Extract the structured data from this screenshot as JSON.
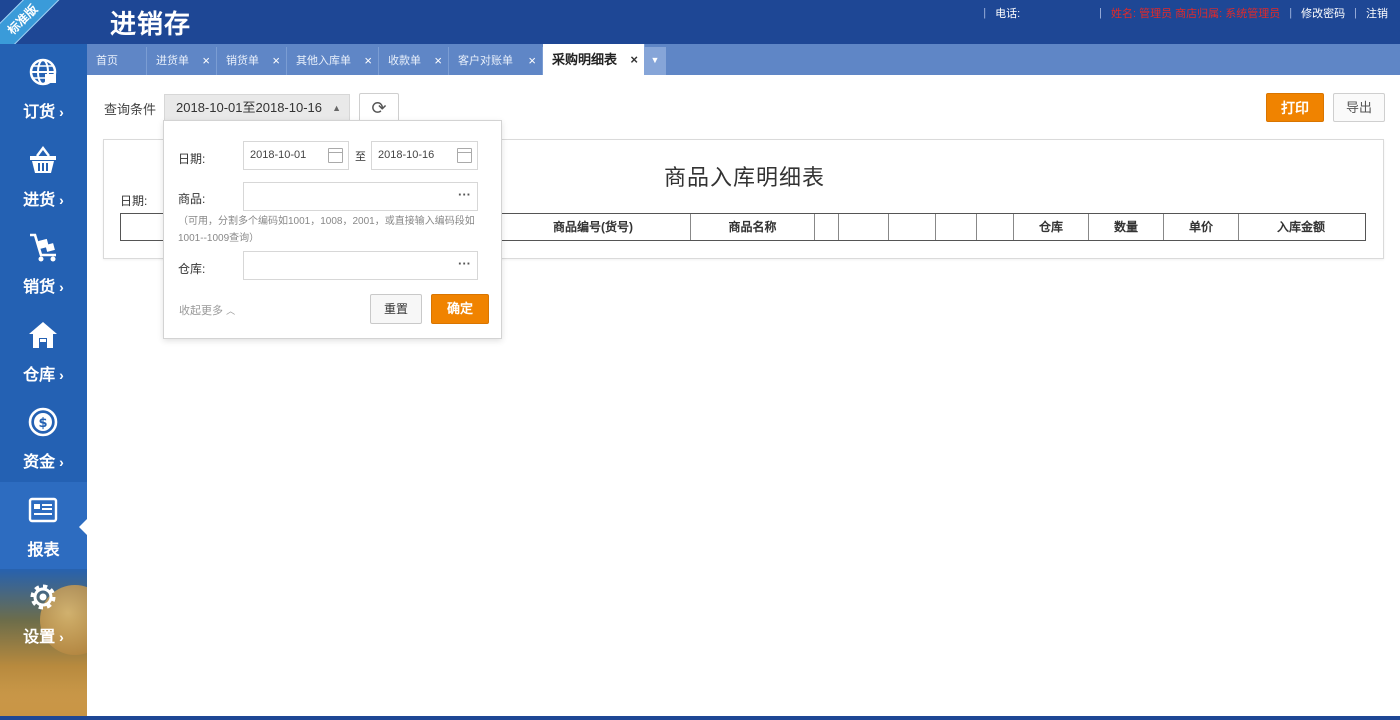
{
  "header": {
    "app_title": "进销存",
    "edition_badge": "标准版",
    "phone_label": "电话:",
    "phone_value": "",
    "user_info": "姓名: 管理员  商店归属: 系统管理员",
    "change_password": "修改密码",
    "logout": "注销"
  },
  "tabs": [
    {
      "label": "首页",
      "closable": false,
      "active": false
    },
    {
      "label": "进货单",
      "closable": true,
      "active": false
    },
    {
      "label": "销货单",
      "closable": true,
      "active": false
    },
    {
      "label": "其他入库单",
      "closable": true,
      "active": false
    },
    {
      "label": "收款单",
      "closable": true,
      "active": false
    },
    {
      "label": "客户对账单",
      "closable": true,
      "active": false
    },
    {
      "label": "采购明细表",
      "closable": true,
      "active": true
    }
  ],
  "tab_close_glyph": "×",
  "sidebar": {
    "items": [
      {
        "label": "订货",
        "icon": "globe-icon",
        "active": false
      },
      {
        "label": "进货",
        "icon": "basket-icon",
        "active": false
      },
      {
        "label": "销货",
        "icon": "cart-icon",
        "active": false
      },
      {
        "label": "仓库",
        "icon": "warehouse-icon",
        "active": false
      },
      {
        "label": "资金",
        "icon": "money-icon",
        "active": false
      },
      {
        "label": "报表",
        "icon": "report-icon",
        "active": true
      },
      {
        "label": "设置",
        "icon": "gear-icon",
        "active": false
      }
    ],
    "chevron": "›"
  },
  "toolbar": {
    "query_label": "查询条件",
    "date_range": "2018-10-01至2018-10-16",
    "print": "打印",
    "export": "导出"
  },
  "report": {
    "title": "商品入库明细表",
    "date_label": "日期:",
    "columns": [
      "",
      "",
      "",
      "",
      "",
      "商品编号(货号)",
      "商品名称",
      "",
      "",
      "",
      "",
      "",
      "仓库",
      "数量",
      "单价",
      "入库金额"
    ]
  },
  "filter_panel": {
    "date_label": "日期:",
    "date_from": "2018-10-01",
    "to_label": "至",
    "date_to": "2018-10-16",
    "product_label": "商品:",
    "product_value": "",
    "hint": "（可用，分割多个编码如1001，1008，2001，或直接输入编码段如1001--1009查询）",
    "warehouse_label": "仓库:",
    "warehouse_value": "",
    "collapse": "收起更多",
    "reset": "重置",
    "confirm": "确定"
  },
  "colors": {
    "header_bg": "#1e4795",
    "sidebar_bg": "#2461b3",
    "tabbar_bg": "#5f86c6",
    "accent_orange": "#f08300"
  }
}
